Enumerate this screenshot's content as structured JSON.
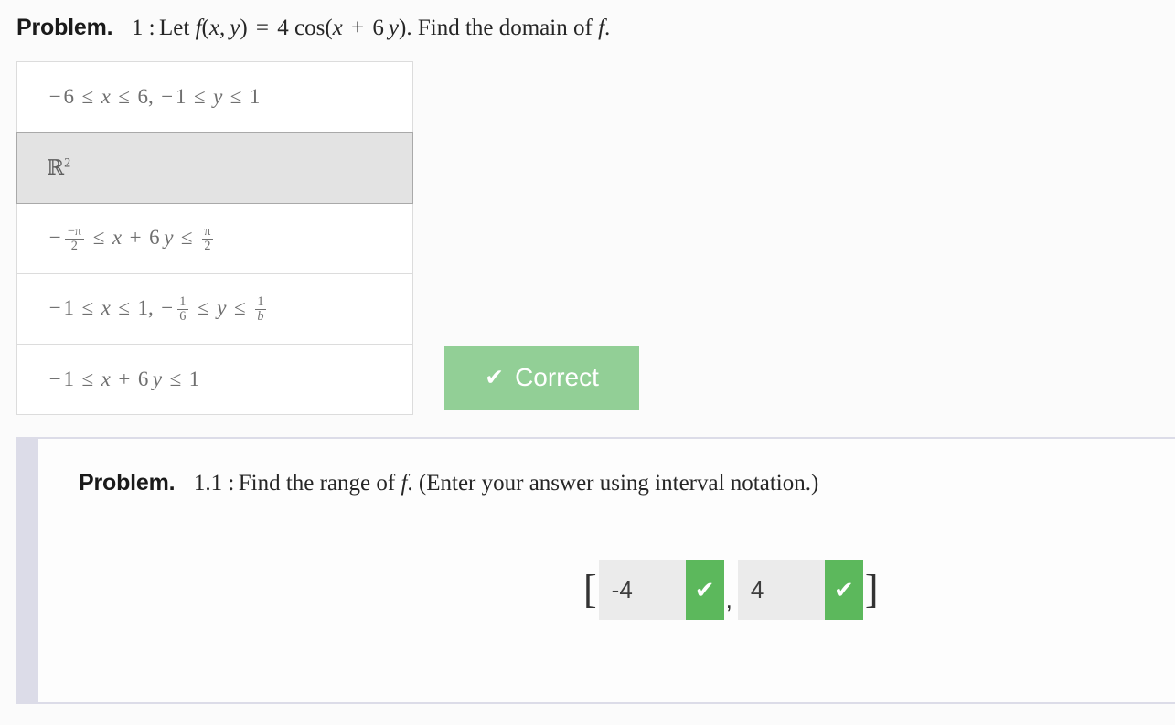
{
  "page": {
    "background_color": "#fbfbfb"
  },
  "problem": {
    "label": "Problem.",
    "number": "1 :",
    "statement_prefix": "Let",
    "statement_suffix": ". Find the domain of",
    "statement_end": ".",
    "function_def": {
      "fname": "f",
      "args": "(x, y)",
      "equals": "=",
      "coefficient": "4",
      "trig": "cos",
      "inner": "(x + 6 y)"
    },
    "domain_variable": "f",
    "options": [
      {
        "id": "option-1",
        "text": "−6 ≤ x ≤ 6, −1 ≤ y ≤ 1",
        "selected": false
      },
      {
        "id": "option-2",
        "text": "ℝ²",
        "selected": true
      },
      {
        "id": "option-3",
        "text": "− −π/2 ≤ x + 6 y ≤ π/2",
        "selected": false
      },
      {
        "id": "option-4",
        "text": "−1 ≤ x ≤ 1, − 1/6 ≤ y ≤ 1/b",
        "selected": false
      },
      {
        "id": "option-5",
        "text": "−1 ≤ x + 6 y ≤ 1",
        "selected": false
      }
    ],
    "feedback": {
      "label": "Correct",
      "icon": "check-icon",
      "color": "#92cf96",
      "text_color": "#ffffff"
    }
  },
  "subproblem": {
    "label": "Problem.",
    "number": "1.1 :",
    "statement": "Find the range of",
    "variable": "f",
    "statement_tail": ". (Enter your answer using interval notation.)",
    "border_color": "#dcdce8",
    "answer": {
      "open_bracket": "[",
      "separator": ",",
      "close_bracket": "]",
      "lower": {
        "value": "-4",
        "placeholder": "",
        "status_icon": "check-icon",
        "status_color": "#5cb85c"
      },
      "upper": {
        "value": "4",
        "placeholder": "",
        "status_icon": "check-icon",
        "status_color": "#5cb85c"
      }
    }
  },
  "glyphs": {
    "check": "✔",
    "leq": "≤",
    "minus": "−",
    "plus": "+",
    "pi": "π",
    "reals": "ℝ"
  }
}
